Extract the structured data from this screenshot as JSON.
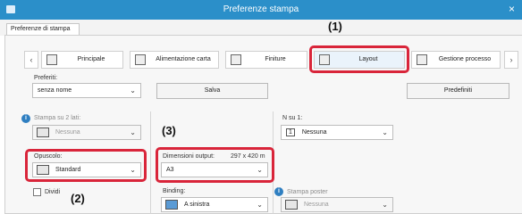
{
  "window": {
    "title": "Preferenze stampa",
    "close_glyph": "×"
  },
  "tab": {
    "label": "Preferenze di stampa"
  },
  "nav": {
    "prev": "‹",
    "next": "›",
    "tabs": [
      {
        "label": "Principale",
        "icon": "home-icon"
      },
      {
        "label": "Alimentazione carta",
        "icon": "paper-tray-icon"
      },
      {
        "label": "Finiture",
        "icon": "finishing-icon"
      },
      {
        "label": "Layout",
        "icon": "layout-icon"
      },
      {
        "label": "Gestione processo",
        "icon": "job-handling-icon"
      }
    ]
  },
  "favorites": {
    "label": "Preferiti:",
    "value": "senza nome",
    "save": "Salva",
    "defaults": "Predefiniti"
  },
  "duplex": {
    "label": "Stampa su 2 lati:",
    "value": "Nessuna"
  },
  "n_up": {
    "label": "N su 1:",
    "value": "1",
    "option": "Nessuna"
  },
  "booklet": {
    "label": "Opuscolo:",
    "value": "Standard"
  },
  "output_size": {
    "label": "Dimensioni output:",
    "dims": "297 x 420 m",
    "value": "A3"
  },
  "split": {
    "label": "Dividi"
  },
  "binding": {
    "label": "Binding:",
    "value": "A sinistra"
  },
  "poster": {
    "label": "Stampa poster",
    "value": "Nessuna"
  },
  "callouts": {
    "c1": "(1)",
    "c2": "(2)",
    "c3": "(3)"
  },
  "colors": {
    "titlebar": "#2b8fc9",
    "highlight": "#d9253a"
  }
}
